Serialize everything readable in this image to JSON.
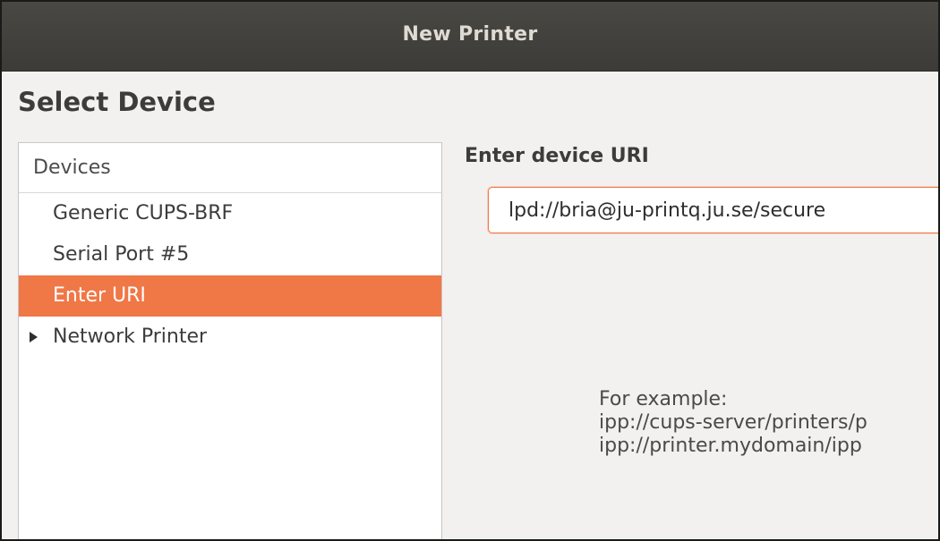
{
  "window": {
    "title": "New Printer"
  },
  "page": {
    "heading": "Select Device"
  },
  "device_list": {
    "header": "Devices",
    "items": [
      {
        "label": "Generic CUPS-BRF",
        "selected": false,
        "expandable": false
      },
      {
        "label": "Serial Port #5",
        "selected": false,
        "expandable": false
      },
      {
        "label": "Enter URI",
        "selected": true,
        "expandable": false
      },
      {
        "label": "Network Printer",
        "selected": false,
        "expandable": true
      }
    ]
  },
  "uri_panel": {
    "label": "Enter device URI",
    "value": "lpd://bria@ju-printq.ju.se/secure",
    "example_heading": "For example:",
    "example_lines": [
      "ipp://cups-server/printers/p",
      "ipp://printer.mydomain/ipp"
    ]
  },
  "colors": {
    "accent": "#f07746",
    "titlebar": "#3c3b37",
    "window_bg": "#f2f1f0"
  }
}
